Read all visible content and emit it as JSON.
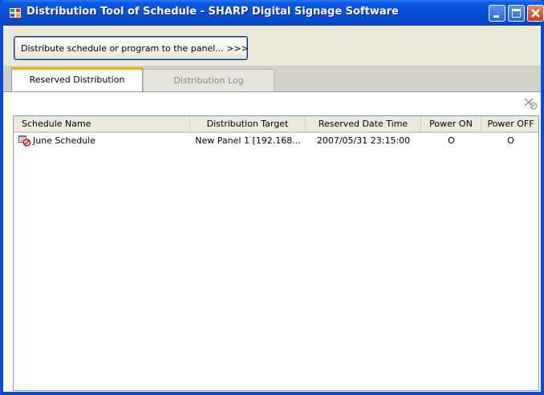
{
  "window": {
    "title": "Distribution Tool of Schedule - SHARP Digital Signage Software",
    "controls": {
      "minimize": "minimize-button",
      "maximize": "maximize-button",
      "close": "close-button"
    }
  },
  "toolbar": {
    "distribute_label": "Distribute schedule or program to the panel... >>>"
  },
  "tabs": [
    {
      "label": "Reserved Distribution",
      "active": true
    },
    {
      "label": "Distribution Log",
      "active": false
    }
  ],
  "panel": {
    "cancel_icon": "cancel-reservation-icon"
  },
  "table": {
    "columns": [
      "Schedule Name",
      "Distribution Target",
      "Reserved Date Time",
      "Power ON",
      "Power OFF"
    ],
    "rows": [
      {
        "icon": "schedule-reserved-icon",
        "name": "June Schedule",
        "target": "New Panel 1 [192.168...",
        "datetime": "2007/05/31 23:15:00",
        "power_on": "O",
        "power_off": "O"
      }
    ]
  },
  "colors": {
    "titlebar": "#0a4fd8",
    "window_bg": "#ece9d8",
    "active_tab_accent": "#e8b200",
    "close_button": "#c8401e"
  }
}
